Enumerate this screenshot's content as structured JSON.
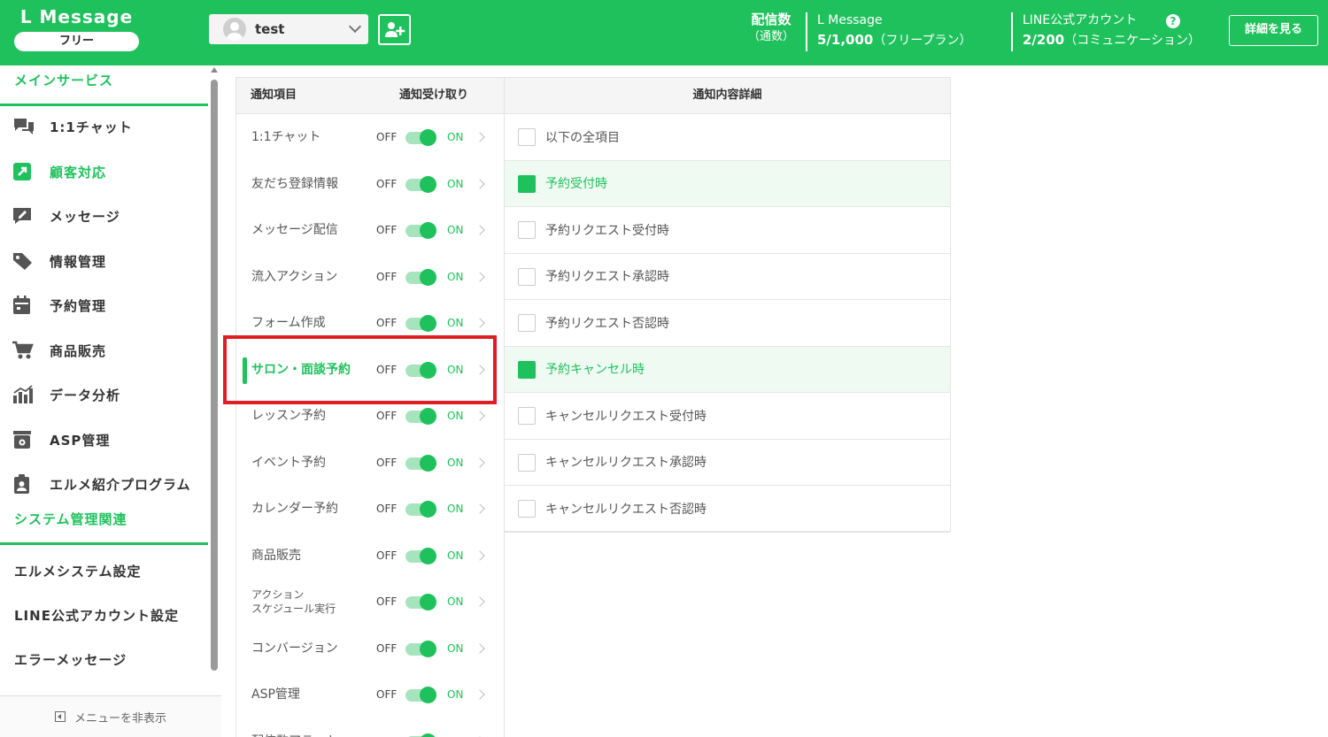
{
  "header": {
    "brand_name": "L Message",
    "plan": "フリー",
    "account_name": "test",
    "stat_label": "配信数",
    "stat_sub": "（通数）",
    "lmessage_title": "L Message",
    "lmessage_count": "5/1,000",
    "lmessage_plan": "（フリープラン）",
    "line_title": "LINE公式アカウント",
    "line_count": "2/200",
    "line_plan": "（コミュニケーション）",
    "detail_button": "詳細を見る",
    "accent_color": "#1fc15c"
  },
  "sidebar": {
    "main_section": "メインサービス",
    "items": [
      {
        "label": "1:1チャット",
        "icon": "chat-icon"
      },
      {
        "label": "顧客対応",
        "icon": "external-link-icon",
        "active": true
      },
      {
        "label": "メッセージ",
        "icon": "edit-message-icon"
      },
      {
        "label": "情報管理",
        "icon": "tag-icon"
      },
      {
        "label": "予約管理",
        "icon": "calendar-icon"
      },
      {
        "label": "商品販売",
        "icon": "cart-icon"
      },
      {
        "label": "データ分析",
        "icon": "bar-chart-icon"
      },
      {
        "label": "ASP管理",
        "icon": "asp-box-icon"
      },
      {
        "label": "エルメ紹介プログラム",
        "icon": "clipboard-user-icon"
      }
    ],
    "system_section": "システム管理関連",
    "system_items": [
      "エルメシステム設定",
      "LINE公式アカウント設定",
      "エラーメッセージ"
    ],
    "hide_menu": "メニューを非表示"
  },
  "table": {
    "col_item": "通知項目",
    "col_receive": "通知受け取り",
    "col_detail": "通知内容詳細",
    "off_label": "OFF",
    "on_label": "ON",
    "rows": [
      {
        "label": "1:1チャット"
      },
      {
        "label": "友だち登録情報"
      },
      {
        "label": "メッセージ配信"
      },
      {
        "label": "流入アクション"
      },
      {
        "label": "フォーム作成"
      },
      {
        "label": "サロン・面談予約",
        "active": true
      },
      {
        "label": "レッスン予約"
      },
      {
        "label": "イベント予約"
      },
      {
        "label": "カレンダー予約"
      },
      {
        "label": "商品販売"
      },
      {
        "label": "アクション\nスケジュール実行",
        "small": true
      },
      {
        "label": "コンバージョン"
      },
      {
        "label": "ASP管理"
      },
      {
        "label": "配信数アラート"
      }
    ],
    "details": [
      {
        "label": "以下の全項目",
        "checked": false
      },
      {
        "label": "予約受付時",
        "checked": true
      },
      {
        "label": "予約リクエスト受付時",
        "checked": false
      },
      {
        "label": "予約リクエスト承認時",
        "checked": false
      },
      {
        "label": "予約リクエスト否認時",
        "checked": false
      },
      {
        "label": "予約キャンセル時",
        "checked": true
      },
      {
        "label": "キャンセルリクエスト受付時",
        "checked": false
      },
      {
        "label": "キャンセルリクエスト承認時",
        "checked": false
      },
      {
        "label": "キャンセルリクエスト否認時",
        "checked": false
      }
    ]
  }
}
